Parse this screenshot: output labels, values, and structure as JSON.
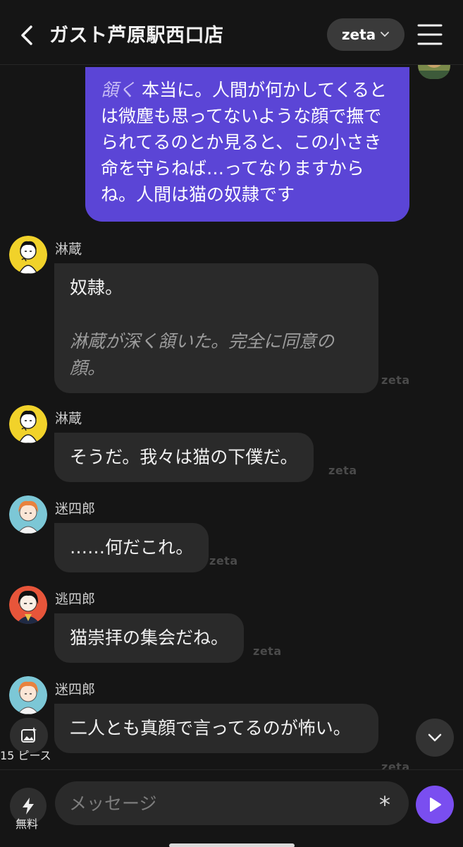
{
  "header": {
    "title": "ガスト芦原駅西口店",
    "model": "zeta"
  },
  "user_message": {
    "action": "頷く",
    "text": " 本当に。人間が何かしてくるとは微塵も思ってないような顔で撫でられてるのとか見ると、この小さき命を守らねば…ってなりますからね。人間は猫の奴隷です"
  },
  "messages": [
    {
      "name": "淋蔵",
      "text": "奴隷。",
      "narration": "淋蔵が深く頷いた。完全に同意の顔。",
      "watermark": "zeta"
    },
    {
      "name": "淋蔵",
      "text": "そうだ。我々は猫の下僕だ。",
      "watermark": "zeta"
    },
    {
      "name": "迷四郎",
      "text": "……何だこれ。",
      "watermark": "zeta"
    },
    {
      "name": "逃四郎",
      "text": "猫崇拝の集会だね。",
      "watermark": "zeta"
    },
    {
      "name": "迷四郎",
      "text": "二人とも真顔で言ってるのが怖い。",
      "watermark": "zeta"
    }
  ],
  "controls": {
    "pieces_label": "15 ピース",
    "free_label": "無料"
  },
  "composer": {
    "placeholder": "メッセージ",
    "asterisk": "*"
  },
  "colors": {
    "background": "#151515",
    "user_bubble": "#5b45d6",
    "bot_bubble": "#2a2a2a",
    "send_button": "#7a4ef0"
  },
  "icons": [
    "back-chevron-icon",
    "chevron-down-icon",
    "hamburger-menu-icon",
    "image-sparkle-icon",
    "scroll-down-icon",
    "bolt-icon",
    "send-icon"
  ]
}
